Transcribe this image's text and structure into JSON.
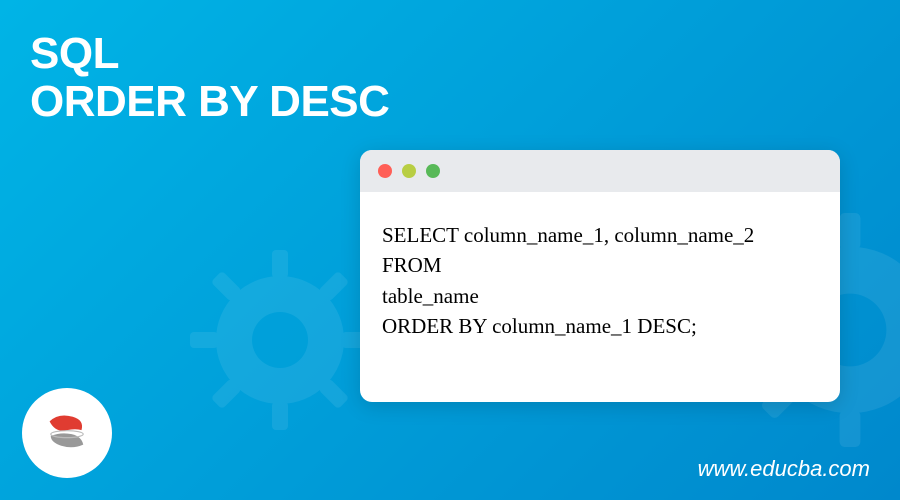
{
  "title_line1": "SQL",
  "title_line2": "ORDER BY DESC",
  "window": {
    "dot_colors": {
      "red": "#ff5f57",
      "yellow": "#b8ce43",
      "green": "#58b958"
    }
  },
  "code": "SELECT column_name_1, column_name_2\nFROM\ntable_name\nORDER BY column_name_1 DESC;",
  "logo": {
    "name": "sql-server-logo",
    "accent_color": "#e03c31",
    "shadow_color": "#999999"
  },
  "footer_url": "www.educba.com"
}
